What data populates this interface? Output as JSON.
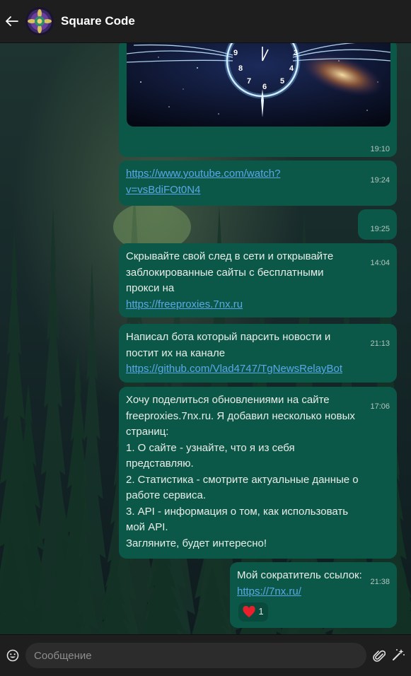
{
  "header": {
    "title": "Square Code",
    "back_icon": "arrow-left-icon",
    "avatar_icon": "mandala-avatar"
  },
  "colors": {
    "bubble": "#0c5848",
    "link": "#5aa7e8",
    "header_bg": "#1e1e1e"
  },
  "messages": [
    {
      "id": "photo",
      "image": "clock-galaxy-photo",
      "image_numbers": [
        "9",
        "3",
        "4",
        "5",
        "6",
        "7",
        "8"
      ],
      "time": "19:10"
    },
    {
      "id": "youtube",
      "parts": [
        {
          "link": "https://www.youtube.com/watch?\nv=vsBdiFOt0N4"
        }
      ],
      "time": "19:24"
    },
    {
      "id": "empty",
      "parts": [],
      "time": "19:25"
    },
    {
      "id": "proxies",
      "parts": [
        {
          "text": "Скрывайте свой след в сети и открывайте\nзаблокированные сайты с бесплатными\nпрокси на\n"
        },
        {
          "link": "https://freeproxies.7nx.ru"
        }
      ],
      "time": "14:04"
    },
    {
      "id": "newsbot",
      "parts": [
        {
          "text": "Написал бота который парсить новости и\nпостит их на канале\n"
        },
        {
          "link": "https://github.com/Vlad4747/TgNewsRelayBot"
        }
      ],
      "time": "21:13"
    },
    {
      "id": "update",
      "parts": [
        {
          "text": "Хочу поделиться обновлениями на сайте\nfreeproxies.7nx.ru. Я добавил несколько новых\nстраниц:\n1. О сайте - узнайте, что я из себя\nпредставляю.\n2. Статистика - смотрите актуальные данные о\nработе сервиса.\n3. API - информация о том, как использовать\nмой API.\nЗагляните, будет интересно!"
        }
      ],
      "time": "17:06"
    },
    {
      "id": "shortener",
      "parts": [
        {
          "text": "Мой сократитель ссылок:\n"
        },
        {
          "link": "https://7nx.ru/"
        }
      ],
      "time": "21:38",
      "reaction": {
        "icon": "red-heart-icon",
        "count": "1"
      }
    }
  ],
  "composer": {
    "placeholder": "Сообщение",
    "emoji_icon": "emoji-icon",
    "attach_icon": "paperclip-icon",
    "magic_icon": "magic-wand-icon"
  }
}
